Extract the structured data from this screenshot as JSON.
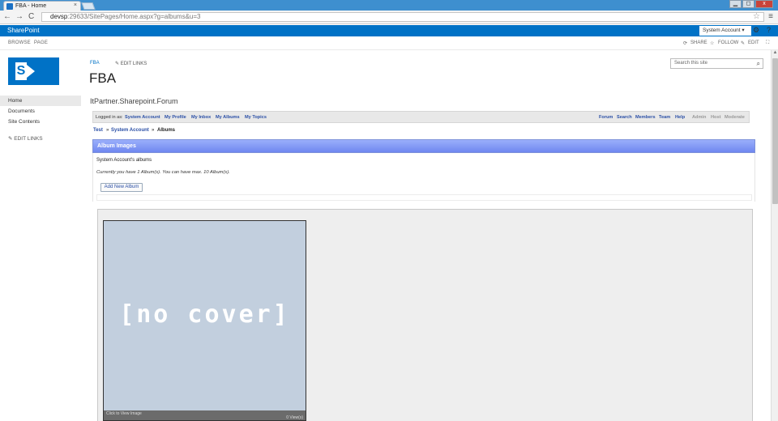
{
  "browser": {
    "tab_title": "FBA - Home",
    "tab_close": "×",
    "url_host": "devsp",
    "url_rest": ":29633/SitePages/Home.aspx?g=albums&u=3",
    "back": "←",
    "forward": "→",
    "reload": "C",
    "star": "☆",
    "menu": "≡",
    "min": "▁",
    "max": "◻",
    "close": "x"
  },
  "suite": {
    "brand": "SharePoint",
    "user": "System Account ▾",
    "gear": "⚙",
    "help": "?"
  },
  "ribbon": {
    "tabs": [
      "BROWSE",
      "PAGE"
    ],
    "share": "SHARE",
    "follow": "FOLLOW",
    "edit": "EDIT"
  },
  "site": {
    "breadcrumb": "FBA",
    "edit_links": "EDIT LINKS",
    "title": "FBA",
    "search_placeholder": "Search this site"
  },
  "quicklaunch": {
    "items": [
      "Home",
      "Documents",
      "Site Contents"
    ],
    "edit_links": "EDIT LINKS"
  },
  "forum": {
    "title": "ItPartner.Sharepoint.Forum",
    "logged_in_as": "Logged in as:",
    "user": "System Account",
    "user_links": [
      "My Profile",
      "My Inbox",
      "My Albums",
      "My Topics"
    ],
    "right_links": [
      "Forum",
      "Search",
      "Members",
      "Team",
      "Help"
    ],
    "admin_links": [
      "Admin",
      "Host",
      "Moderate"
    ],
    "crumbs": [
      "Test",
      "System Account",
      "Albums"
    ],
    "crumb_sep": "»"
  },
  "albums": {
    "header": "Album Images",
    "owner": "System Account's albums",
    "limits": "Currently you have 1 Album(s). You can have max. 10 Album(s).",
    "add_button": "Add New Album",
    "card": {
      "cover_text": "[no cover]",
      "click_text": "Click to View Image",
      "views": "0 View(s)"
    }
  },
  "colors": {
    "suite_blue": "#0072c6",
    "header_gradient_top": "#9aaffb",
    "header_gradient_bottom": "#6f87f0",
    "link_blue": "#2a4fa6"
  }
}
